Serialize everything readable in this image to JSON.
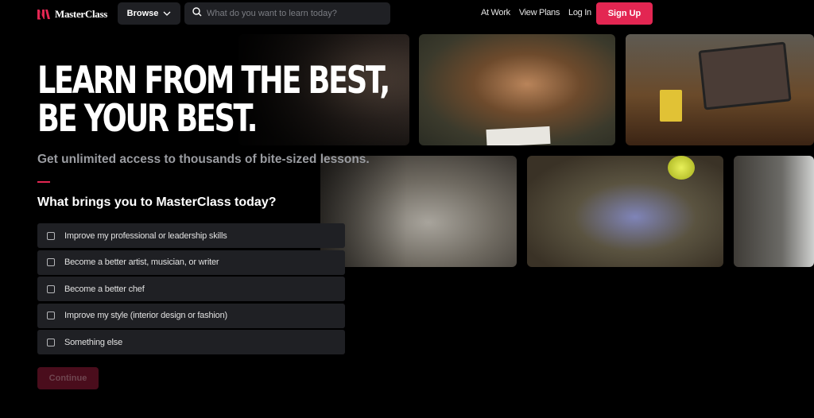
{
  "header": {
    "brand": "MasterClass",
    "browse_label": "Browse",
    "search_placeholder": "What do you want to learn today?",
    "nav_links": [
      "At Work",
      "View Plans",
      "Log In"
    ],
    "signup_label": "Sign Up"
  },
  "hero": {
    "headline_line1": "LEARN FROM THE BEST,",
    "headline_line2": "BE YOUR BEST.",
    "subtitle": "Get unlimited access to thousands of bite-sized lessons.",
    "question": "What brings you to MasterClass today?"
  },
  "options": [
    {
      "label": "Improve my professional or leadership skills",
      "checked": false
    },
    {
      "label": "Become a better artist, musician, or writer",
      "checked": false
    },
    {
      "label": "Become a better chef",
      "checked": false
    },
    {
      "label": "Improve my style (interior design or fashion)",
      "checked": false
    },
    {
      "label": "Something else",
      "checked": false
    }
  ],
  "continue_label": "Continue",
  "colors": {
    "accent": "#e32652",
    "background": "#000000",
    "option_bg": "#1f2024",
    "continue_disabled_bg": "#4a0d1c"
  },
  "tiles": [
    {
      "icon": "person-watching-tablet-image"
    },
    {
      "icon": "actress-reading-script-image"
    },
    {
      "icon": "cocktail-class-tablet-image"
    },
    {
      "icon": "phone-video-lesson-image"
    },
    {
      "icon": "tennis-player-image"
    },
    {
      "icon": "interior-room-image"
    }
  ]
}
